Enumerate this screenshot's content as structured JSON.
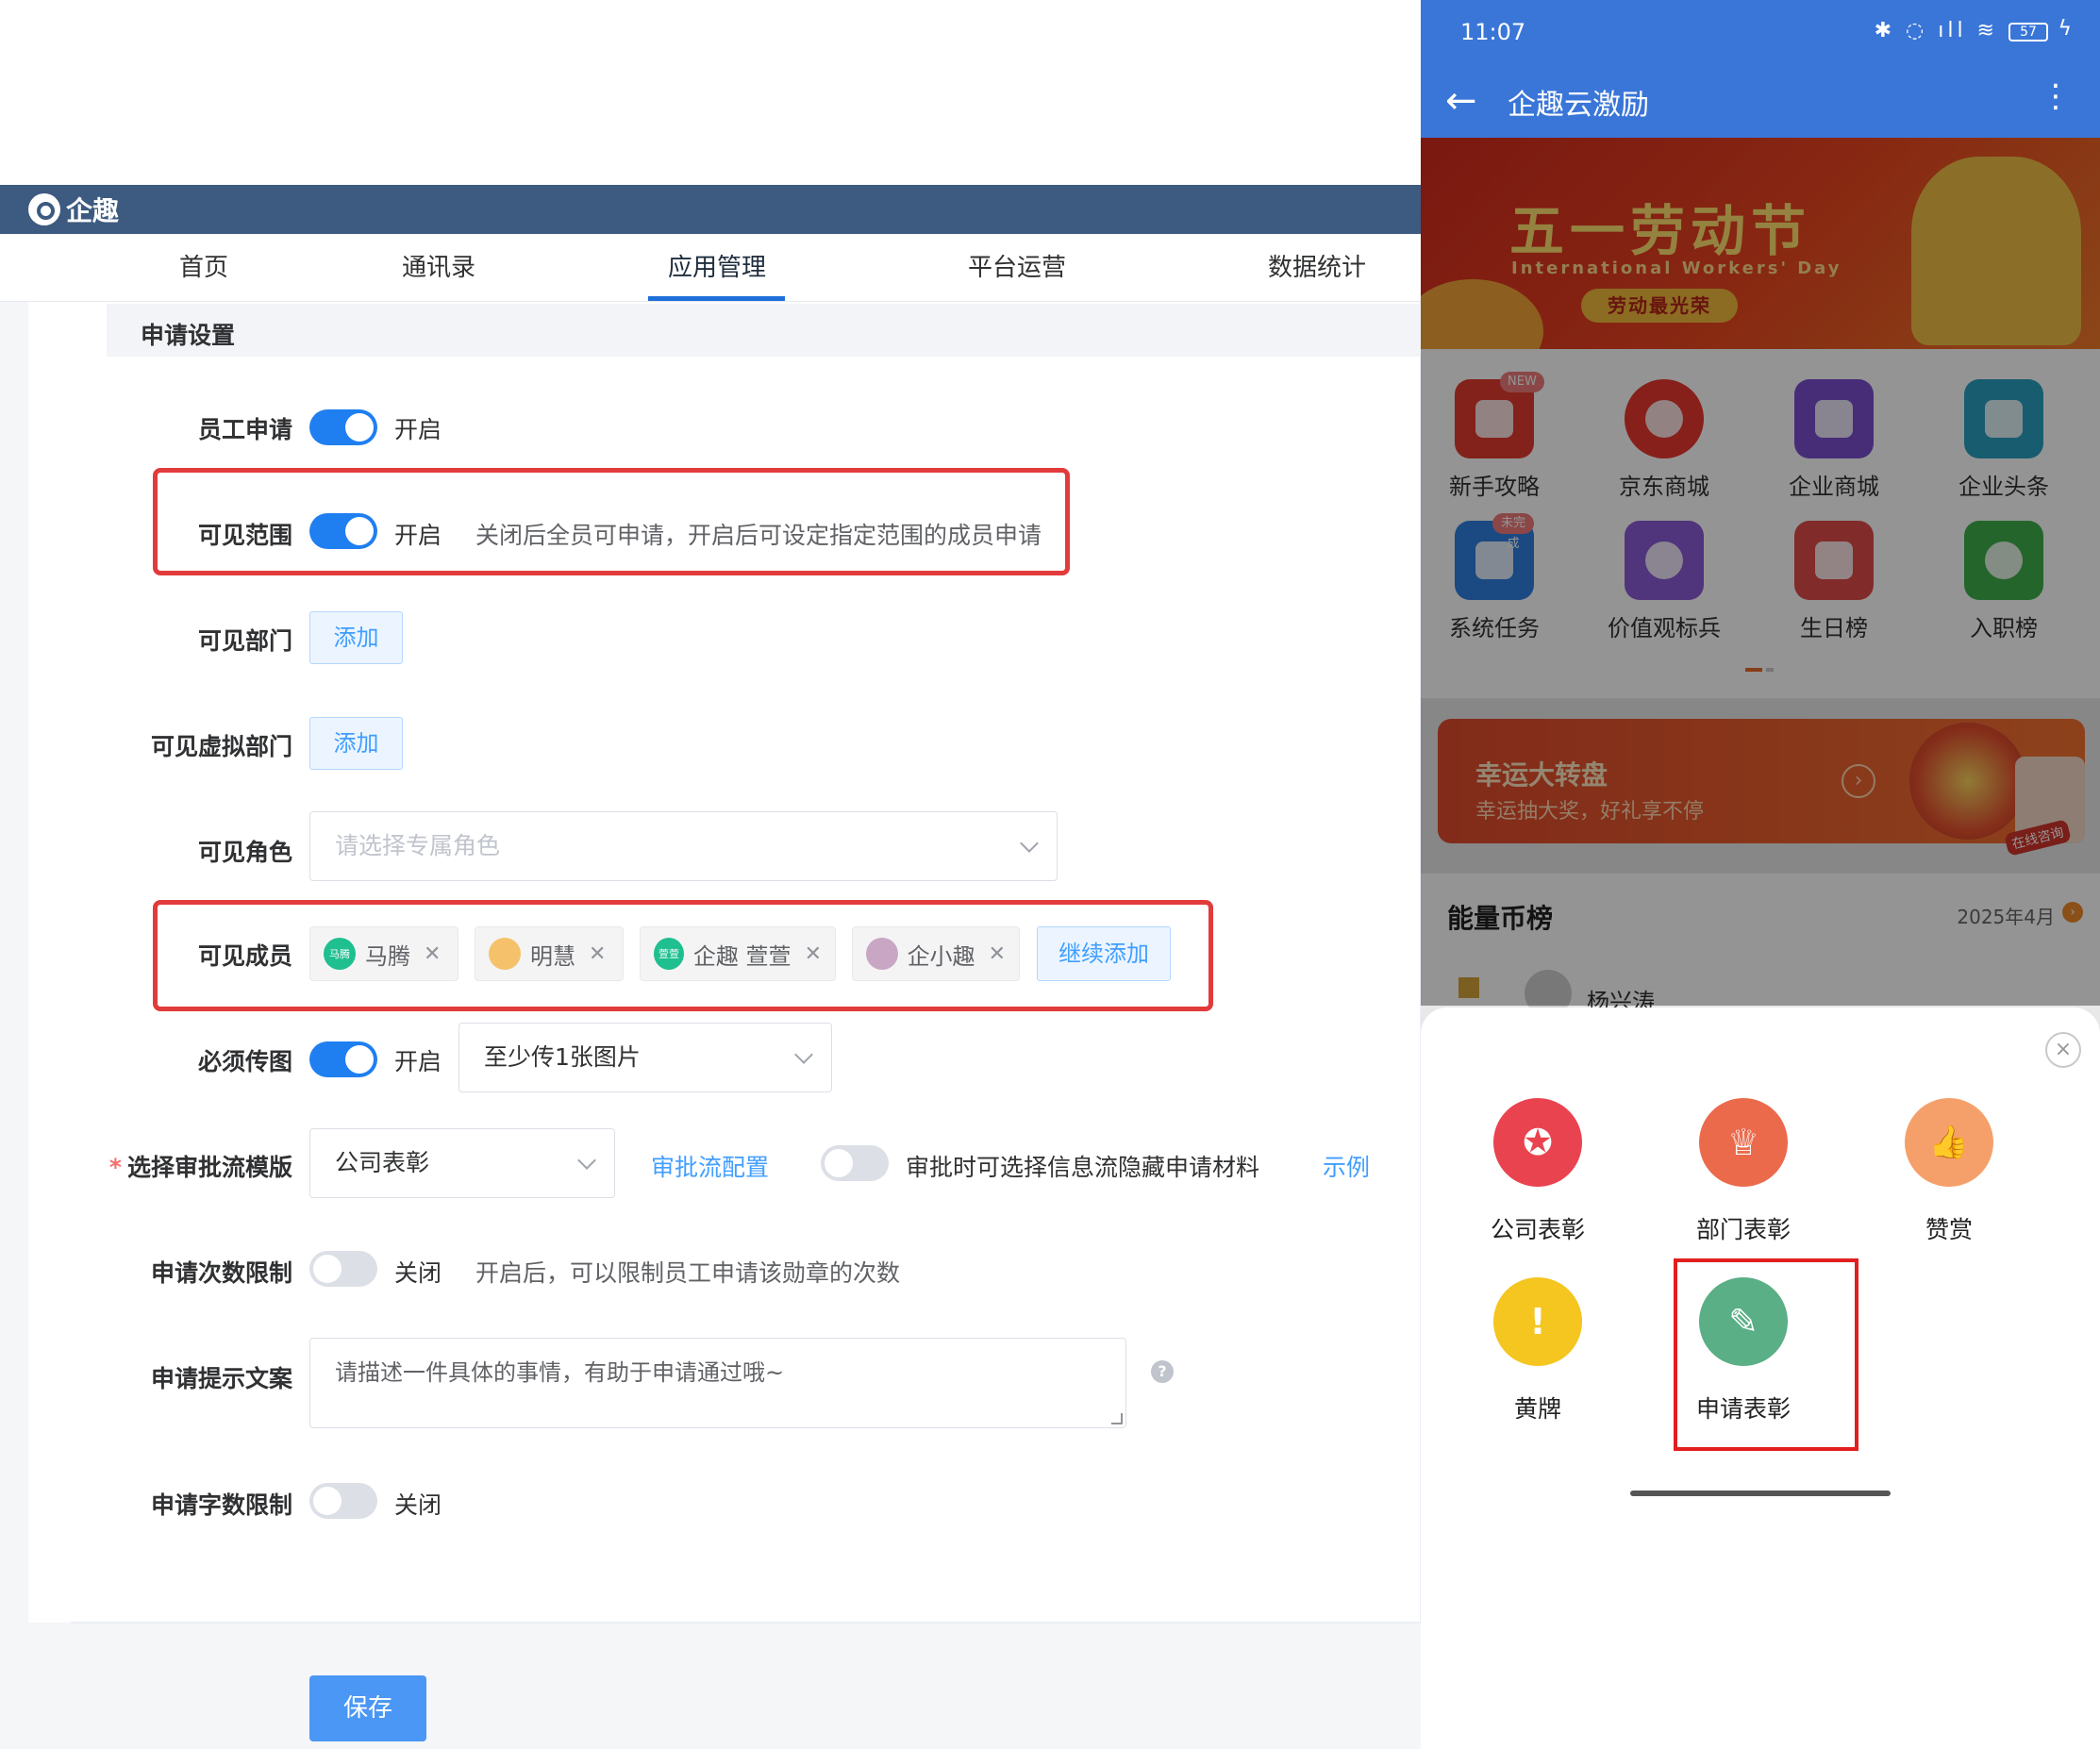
{
  "admin": {
    "brand": "企趣",
    "nav": [
      {
        "label": "首页"
      },
      {
        "label": "通讯录"
      },
      {
        "label": "应用管理"
      },
      {
        "label": "平台运营"
      },
      {
        "label": "数据统计"
      }
    ],
    "active_nav": "应用管理",
    "section_title": "申请设置",
    "employee_apply": {
      "label": "员工申请",
      "state": "开启",
      "on": true
    },
    "visible_scope": {
      "label": "可见范围",
      "state": "开启",
      "on": true,
      "hint": "关闭后全员可申请，开启后可设定指定范围的成员申请"
    },
    "visible_dept": {
      "label": "可见部门",
      "button": "添加"
    },
    "visible_virtual_dept": {
      "label": "可见虚拟部门",
      "button": "添加"
    },
    "visible_role": {
      "label": "可见角色",
      "placeholder": "请选择专属角色"
    },
    "visible_members": {
      "label": "可见成员",
      "members": [
        {
          "name": "马腾",
          "avatar_text": "马腾",
          "color": "#1fbf8f"
        },
        {
          "name": "明慧",
          "avatar_text": "",
          "color": "#f5c26b"
        },
        {
          "name": "企趣 萱萱",
          "avatar_text": "萱萱",
          "color": "#1fbf8f"
        },
        {
          "name": "企小趣",
          "avatar_text": "",
          "color": "#c9a7c4"
        }
      ],
      "add_more": "继续添加"
    },
    "must_upload": {
      "label": "必须传图",
      "state": "开启",
      "on": true,
      "select_value": "至少传1张图片"
    },
    "approval_template": {
      "label": "选择审批流模版",
      "required_mark": "*",
      "select_value": "公司表彰",
      "link": "审批流配置",
      "toggle_on": false,
      "toggle_text": "审批时可选择信息流隐藏申请材料",
      "example": "示例"
    },
    "apply_count_limit": {
      "label": "申请次数限制",
      "state": "关闭",
      "on": false,
      "hint": "开启后，可以限制员工申请该勋章的次数"
    },
    "apply_tip": {
      "label": "申请提示文案",
      "value": "请描述一件具体的事情，有助于申请通过哦~",
      "help": "?"
    },
    "apply_char_limit": {
      "label": "申请字数限制",
      "state": "关闭",
      "on": false
    },
    "save_button": "保存"
  },
  "phone": {
    "time": "11:07",
    "battery": "57",
    "app_title": "企趣云激励",
    "banner": {
      "title": "五一劳动节",
      "subtitle": "International Workers' Day",
      "pill": "劳动最光荣"
    },
    "grid": [
      {
        "label": "新手攻略",
        "color": "#e23b2e",
        "badge": "NEW",
        "icon": "book-icon"
      },
      {
        "label": "京东商城",
        "color": "#e8382f",
        "badge": "",
        "icon": "jd-dog-icon"
      },
      {
        "label": "企业商城",
        "color": "#7a4fcf",
        "badge": "",
        "icon": "store-icon"
      },
      {
        "label": "企业头条",
        "color": "#2a9fbf",
        "badge": "",
        "icon": "news-icon"
      },
      {
        "label": "系统任务",
        "color": "#2f7fe0",
        "badge": "未完成",
        "icon": "task-icon"
      },
      {
        "label": "价值观标兵",
        "color": "#8a5ad6",
        "badge": "",
        "icon": "person-badge-icon"
      },
      {
        "label": "生日榜",
        "color": "#e04a4a",
        "badge": "",
        "icon": "cake-icon"
      },
      {
        "label": "入职榜",
        "color": "#3fae4a",
        "badge": "",
        "icon": "medal-icon"
      }
    ],
    "promo": {
      "title": "幸运大转盘",
      "subtitle": "幸运抽大奖，好礼享不停",
      "consult": "在线咨询",
      "arrow": "›"
    },
    "rank": {
      "title": "能量币榜",
      "date": "2025年4月",
      "first_name": "杨兴涛",
      "arrow": "›"
    },
    "sheet": {
      "close": "×",
      "actions": [
        {
          "label": "公司表彰",
          "color": "#e9434f",
          "glyph": "✪",
          "icon": "medal-icon"
        },
        {
          "label": "部门表彰",
          "color": "#ec6a4c",
          "glyph": "♕",
          "icon": "trophy-icon"
        },
        {
          "label": "赞赏",
          "color": "#f5a06a",
          "glyph": "👍",
          "icon": "thumbs-up-icon"
        },
        {
          "label": "黄牌",
          "color": "#f5c520",
          "glyph": "!",
          "icon": "warning-icon"
        },
        {
          "label": "申请表彰",
          "color": "#5aaf86",
          "glyph": "✎",
          "icon": "edit-icon"
        }
      ]
    }
  }
}
